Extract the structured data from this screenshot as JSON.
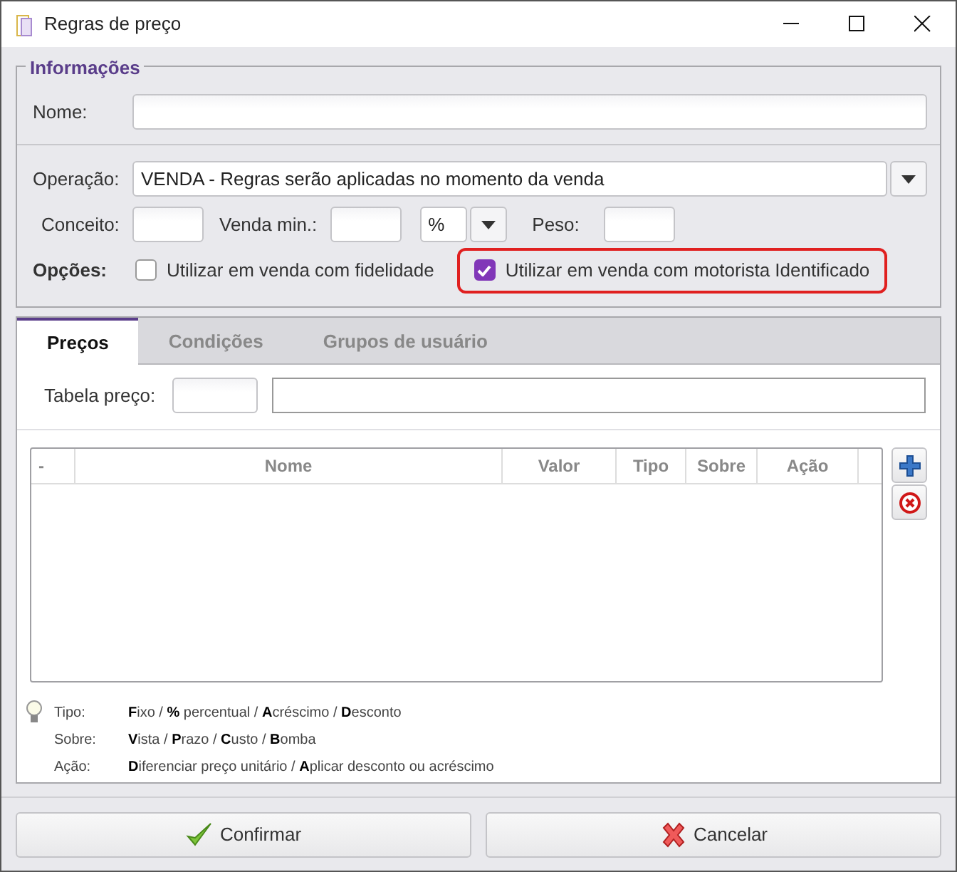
{
  "window": {
    "title": "Regras de preço"
  },
  "info": {
    "legend": "Informações",
    "nome": {
      "label": "Nome:"
    },
    "operacao": {
      "label": "Operação:",
      "value": "VENDA - Regras serão aplicadas no momento da venda"
    },
    "conceito": {
      "label": "Conceito:"
    },
    "venda_min": {
      "label": "Venda min.:",
      "unit": "%"
    },
    "peso": {
      "label": "Peso:"
    },
    "opcoes_label": "Opções:",
    "options": [
      {
        "label": "Utilizar em venda com fidelidade",
        "checked": false,
        "highlighted": false
      },
      {
        "label": "Utilizar em venda com motorista Identificado",
        "checked": true,
        "highlighted": true
      }
    ]
  },
  "tabs": [
    {
      "label": "Preços",
      "selected": true
    },
    {
      "label": "Condições",
      "selected": false
    },
    {
      "label": "Grupos de usuário",
      "selected": false
    }
  ],
  "tabela_preco": {
    "label": "Tabela preço:"
  },
  "table": {
    "columns": [
      "-",
      "Nome",
      "Valor",
      "Tipo",
      "Sobre",
      "Ação"
    ]
  },
  "legend": [
    {
      "key": "Tipo:",
      "text": "**F**ixo / **%** percentual / **A**créscimo / **D**esconto"
    },
    {
      "key": "Sobre:",
      "text": "**V**ista / **P**razo / **C**usto / **B**omba"
    },
    {
      "key": "Ação:",
      "text": "**D**iferenciar preço unitário / **A**plicar desconto ou acréscimo"
    }
  ],
  "buttons": [
    {
      "label": "Confirmar",
      "kind": "confirm"
    },
    {
      "label": "Cancelar",
      "kind": "cancel"
    }
  ]
}
